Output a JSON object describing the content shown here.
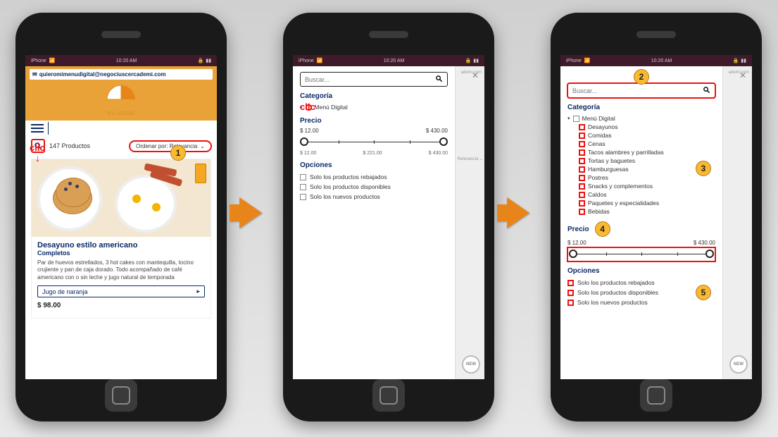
{
  "status": {
    "carrier": "iPhone",
    "time": "10:20 AM",
    "icons": "📶 🔋"
  },
  "phone1": {
    "email": "quieromimenudigital@negociuscercademi.com",
    "logo_caption": "SU LOGO",
    "count": "147 Productos",
    "sort_label": "Ordenar por: Relevancia",
    "card": {
      "title": "Desayuno estilo americano",
      "subtitle": "Completos",
      "desc": "Par de huevos estrellados, 3 hot cakes con mantequilla, tocino crujiente y pan de caja dorado. Todo acompañado de café americano con o sin leche y jugo natural de temporada",
      "variant": "Jugo de naranja",
      "price": "$ 98.00"
    },
    "clic_label": "clic",
    "callout1": "1"
  },
  "phone2": {
    "search_placeholder": "Buscar...",
    "clic_label": "clic",
    "cat_title": "Categoría",
    "cat_root": "Menú Digital",
    "price_title": "Precio",
    "price_min": "$ 12.00",
    "price_max": "$ 430.00",
    "price_b1": "$ 12.00",
    "price_b2": "$ 221.00",
    "price_b3": "$ 430.00",
    "opt_title": "Opciones",
    "opt1": "Solo los productos rebajados",
    "opt2": "Solo los productos disponibles",
    "opt3": "Solo los nuevos productos"
  },
  "phone3": {
    "search_placeholder": "Buscar...",
    "cat_title": "Categoría",
    "cat_root": "Menú Digital",
    "cats": [
      "Desayunos",
      "Comidas",
      "Cenas",
      "Tacos alambres y parrilladas",
      "Tortas y baguetes",
      "Hamburguesas",
      "Postres",
      "Snacks y complementos",
      "Caldos",
      "Paquetes y especialidades",
      "Bebidas"
    ],
    "price_title": "Precio",
    "price_min": "$ 12.00",
    "price_max": "$ 430.00",
    "opt_title": "Opciones",
    "opt1": "Solo los productos rebajados",
    "opt2": "Solo los productos disponibles",
    "opt3": "Solo los nuevos productos",
    "callout2": "2",
    "callout3": "3",
    "callout4": "4",
    "callout5": "5",
    "new_badge": "NEW"
  }
}
